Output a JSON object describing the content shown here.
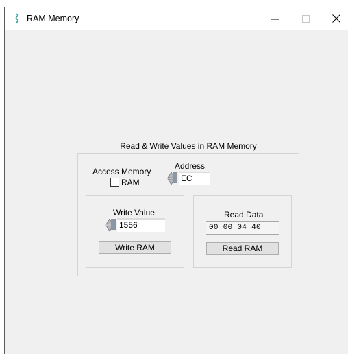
{
  "window": {
    "title": "RAM Memory",
    "icon": "lab-app-icon",
    "controls": [
      "minimize",
      "maximize",
      "close"
    ]
  },
  "group": {
    "title": "Read & Write Values in RAM Memory"
  },
  "access": {
    "label": "Access Memory",
    "checkbox_label": "RAM",
    "checked": false
  },
  "address": {
    "label": "Address",
    "value": "EC"
  },
  "write": {
    "label": "Write Value",
    "value": "1556",
    "button_label": "Write RAM"
  },
  "read": {
    "label": "Read Data",
    "value": "00 00 04 40",
    "button_label": "Read RAM"
  }
}
